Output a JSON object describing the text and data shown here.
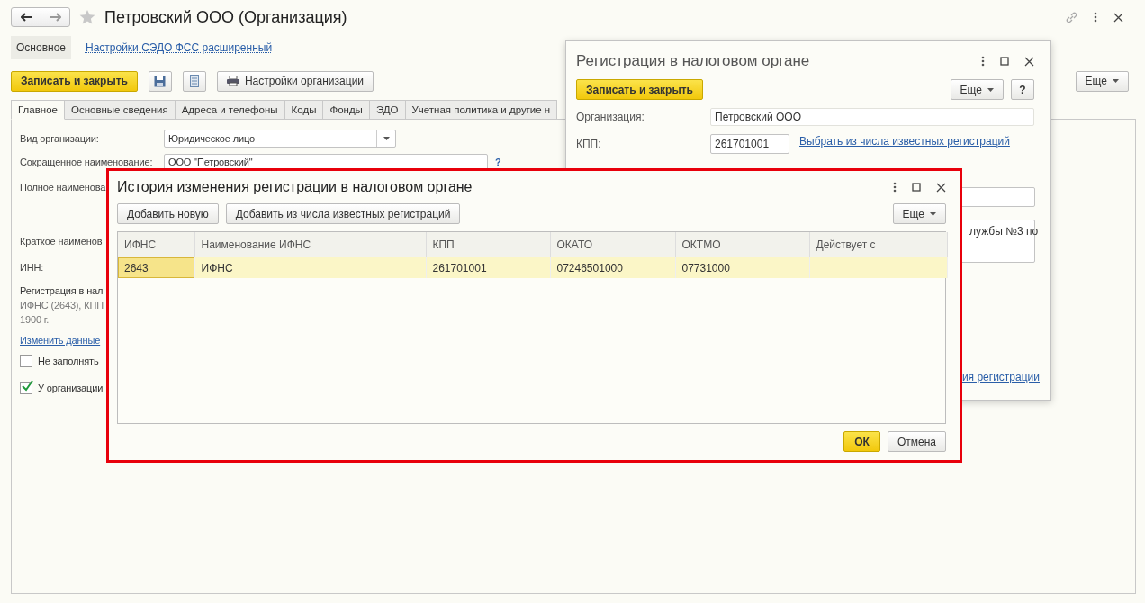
{
  "window": {
    "title": "Петровский ООО (Организация)"
  },
  "nav_tabs": [
    {
      "label": "Основное",
      "selected": true
    },
    {
      "label": "Настройки СЭДО ФСС расширенный",
      "selected": false
    }
  ],
  "toolbar": {
    "save_close": "Записать и закрыть",
    "org_settings": "Настройки организации",
    "more": "Еще"
  },
  "tabs": [
    {
      "label": "Главное",
      "selected": true
    },
    {
      "label": "Основные сведения",
      "selected": false
    },
    {
      "label": "Адреса и телефоны",
      "selected": false
    },
    {
      "label": "Коды",
      "selected": false
    },
    {
      "label": "Фонды",
      "selected": false
    },
    {
      "label": "ЭДО",
      "selected": false
    },
    {
      "label": "Учетная политика и другие н",
      "selected": false
    }
  ],
  "form": {
    "org_type": {
      "label": "Вид организации:",
      "value": "Юридическое лицо"
    },
    "short_name": {
      "label": "Сокращенное наименование:",
      "value": "ООО \"Петровский\"",
      "help": "?"
    },
    "full_name_label": "Полное наименова",
    "brief_name_label": "Краткое наименов",
    "inn_label": "ИНН:",
    "registration_label": "Регистрация в нал",
    "registration_text": [
      "ИФНС (2643), КПП",
      "1900 г."
    ],
    "change_link": "Изменить данные",
    "checkboxes": [
      {
        "label": "Не заполнять",
        "checked": false
      },
      {
        "label": "У организации",
        "checked": true
      }
    ]
  },
  "registration_dialog": {
    "title": "Регистрация в налоговом органе",
    "save_close": "Записать и закрыть",
    "more": "Еще",
    "help": "?",
    "organization": {
      "label": "Организация:",
      "value": "Петровский ООО"
    },
    "kpp": {
      "label": "КПП:",
      "value": "261701001"
    },
    "choose_link": "Выбрать из числа известных регистраций",
    "name_fragment": "лужбы №3 по",
    "history_link_fragment": "ия регистрации"
  },
  "history_dialog": {
    "title": "История изменения регистрации в налоговом органе",
    "buttons": [
      "Добавить новую",
      "Добавить из числа известных регистраций"
    ],
    "more": "Еще",
    "columns": [
      "ИФНС",
      "Наименование ИФНС",
      "КПП",
      "ОКАТО",
      "ОКТМО",
      "Действует с"
    ],
    "rows": [
      {
        "cells": [
          "2643",
          "ИФНС",
          "261701001",
          "07246501000",
          "07731000",
          ""
        ],
        "selected": true
      }
    ],
    "ok": "ОК",
    "cancel": "Отмена"
  }
}
